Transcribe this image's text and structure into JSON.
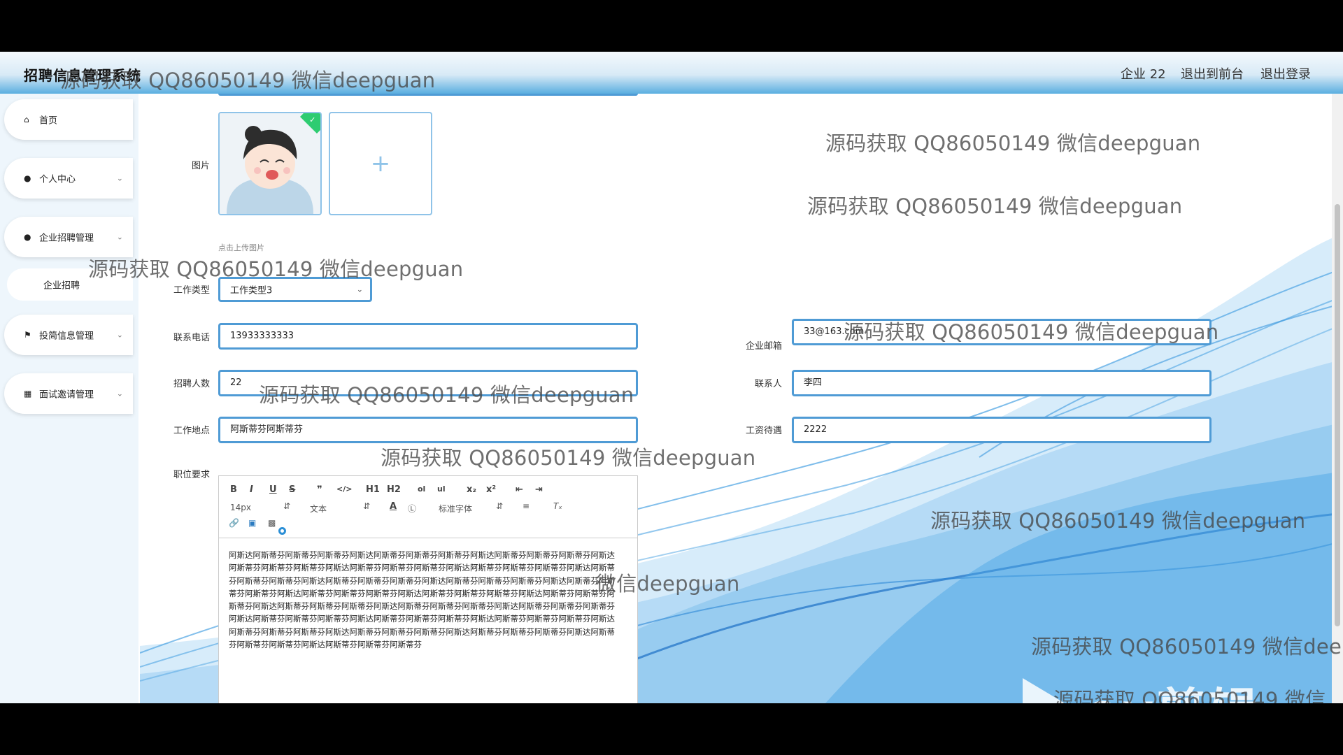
{
  "app": {
    "title": "招聘信息管理系统"
  },
  "header": {
    "user_label": "企业 22",
    "front_link": "退出到前台",
    "logout_link": "退出登录"
  },
  "sidebar": {
    "items": [
      {
        "label": "首页",
        "icon": "home-icon"
      },
      {
        "label": "个人中心",
        "icon": "user-icon"
      },
      {
        "label": "企业招聘管理",
        "icon": "user-icon"
      },
      {
        "label": "企业招聘",
        "icon": ""
      },
      {
        "label": "投简信息管理",
        "icon": "flag-icon"
      },
      {
        "label": "面试邀请管理",
        "icon": "id-card-icon"
      }
    ]
  },
  "form": {
    "image_label": "图片",
    "upload_hint": "点击上传图片",
    "job_type_label": "工作类型",
    "job_type_value": "工作类型3",
    "phone_label": "联系电话",
    "phone_value": "13933333333",
    "headcount_label": "招聘人数",
    "headcount_value": "22",
    "location_label": "工作地点",
    "location_value": "阿斯蒂芬阿斯蒂芬",
    "requirements_label": "职位要求",
    "email_label": "企业邮箱",
    "email_value": "33@163.com",
    "contact_label": "联系人",
    "contact_value": "李四",
    "salary_label": "工资待遇",
    "salary_value": "2222"
  },
  "editor": {
    "font_size": "14px",
    "text_type": "文本",
    "font_family": "标准字体",
    "toolbar_row1": [
      "B",
      "I",
      "U",
      "S",
      "❞",
      "</>",
      "H1",
      "H2",
      "ol",
      "ul",
      "x₂",
      "x²",
      "⇤",
      "⇥"
    ],
    "content": "阿斯达阿斯蒂芬阿斯蒂芬阿斯蒂芬阿斯达阿斯蒂芬阿斯蒂芬阿斯蒂芬阿斯达阿斯蒂芬阿斯蒂芬阿斯蒂芬阿斯达阿斯蒂芬阿斯蒂芬阿斯蒂芬阿斯达阿斯蒂芬阿斯蒂芬阿斯蒂芬阿斯达阿斯蒂芬阿斯蒂芬阿斯蒂芬阿斯达阿斯蒂芬阿斯蒂芬阿斯蒂芬阿斯达阿斯蒂芬阿斯蒂芬阿斯蒂芬阿斯达阿斯蒂芬阿斯蒂芬阿斯蒂芬阿斯达阿斯蒂芬阿斯蒂芬阿斯蒂芬阿斯达阿斯蒂芬阿斯蒂芬阿斯蒂芬阿斯达阿斯蒂芬阿斯蒂芬阿斯蒂芬阿斯达阿斯蒂芬阿斯蒂芬阿斯蒂芬阿斯达阿斯蒂芬阿斯蒂芬阿斯蒂芬阿斯达阿斯蒂芬阿斯蒂芬阿斯蒂芬阿斯达阿斯蒂芬阿斯蒂芬阿斯蒂芬阿斯达阿斯蒂芬阿斯蒂芬阿斯蒂芬阿斯达阿斯蒂芬阿斯蒂芬阿斯蒂芬阿斯达阿斯蒂芬阿斯蒂芬阿斯蒂芬阿斯达阿斯蒂芬阿斯蒂芬阿斯蒂芬阿斯达阿斯蒂芬阿斯蒂芬阿斯蒂芬阿斯达阿斯蒂芬阿斯蒂芬阿斯蒂芬阿斯达阿斯蒂芬阿斯蒂芬阿斯蒂芬阿斯达阿斯蒂芬阿斯蒂芬阿斯蒂芬"
  },
  "watermark": {
    "text": "源码获取 QQ86050149 微信deepguan",
    "partial_1": "源码获取 QQ86050149 微信dee",
    "partial_2": "源码获取 QQ86050149 微信",
    "partial_3": "微信deepguan"
  },
  "branding": {
    "ev_text": "ev剪辑"
  },
  "colors": {
    "accent": "#4f9bd5",
    "header_gradient_end": "#5aaee0",
    "badge_green": "#2ecc71"
  }
}
